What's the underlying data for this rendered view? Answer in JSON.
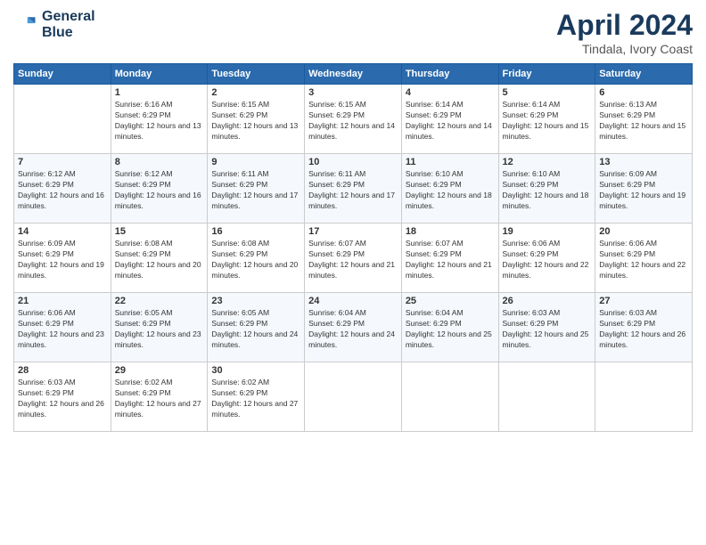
{
  "logo": {
    "line1": "General",
    "line2": "Blue"
  },
  "title": "April 2024",
  "location": "Tindala, Ivory Coast",
  "weekdays": [
    "Sunday",
    "Monday",
    "Tuesday",
    "Wednesday",
    "Thursday",
    "Friday",
    "Saturday"
  ],
  "weeks": [
    [
      {
        "num": "",
        "sunrise": "",
        "sunset": "",
        "daylight": ""
      },
      {
        "num": "1",
        "sunrise": "Sunrise: 6:16 AM",
        "sunset": "Sunset: 6:29 PM",
        "daylight": "Daylight: 12 hours and 13 minutes."
      },
      {
        "num": "2",
        "sunrise": "Sunrise: 6:15 AM",
        "sunset": "Sunset: 6:29 PM",
        "daylight": "Daylight: 12 hours and 13 minutes."
      },
      {
        "num": "3",
        "sunrise": "Sunrise: 6:15 AM",
        "sunset": "Sunset: 6:29 PM",
        "daylight": "Daylight: 12 hours and 14 minutes."
      },
      {
        "num": "4",
        "sunrise": "Sunrise: 6:14 AM",
        "sunset": "Sunset: 6:29 PM",
        "daylight": "Daylight: 12 hours and 14 minutes."
      },
      {
        "num": "5",
        "sunrise": "Sunrise: 6:14 AM",
        "sunset": "Sunset: 6:29 PM",
        "daylight": "Daylight: 12 hours and 15 minutes."
      },
      {
        "num": "6",
        "sunrise": "Sunrise: 6:13 AM",
        "sunset": "Sunset: 6:29 PM",
        "daylight": "Daylight: 12 hours and 15 minutes."
      }
    ],
    [
      {
        "num": "7",
        "sunrise": "Sunrise: 6:12 AM",
        "sunset": "Sunset: 6:29 PM",
        "daylight": "Daylight: 12 hours and 16 minutes."
      },
      {
        "num": "8",
        "sunrise": "Sunrise: 6:12 AM",
        "sunset": "Sunset: 6:29 PM",
        "daylight": "Daylight: 12 hours and 16 minutes."
      },
      {
        "num": "9",
        "sunrise": "Sunrise: 6:11 AM",
        "sunset": "Sunset: 6:29 PM",
        "daylight": "Daylight: 12 hours and 17 minutes."
      },
      {
        "num": "10",
        "sunrise": "Sunrise: 6:11 AM",
        "sunset": "Sunset: 6:29 PM",
        "daylight": "Daylight: 12 hours and 17 minutes."
      },
      {
        "num": "11",
        "sunrise": "Sunrise: 6:10 AM",
        "sunset": "Sunset: 6:29 PM",
        "daylight": "Daylight: 12 hours and 18 minutes."
      },
      {
        "num": "12",
        "sunrise": "Sunrise: 6:10 AM",
        "sunset": "Sunset: 6:29 PM",
        "daylight": "Daylight: 12 hours and 18 minutes."
      },
      {
        "num": "13",
        "sunrise": "Sunrise: 6:09 AM",
        "sunset": "Sunset: 6:29 PM",
        "daylight": "Daylight: 12 hours and 19 minutes."
      }
    ],
    [
      {
        "num": "14",
        "sunrise": "Sunrise: 6:09 AM",
        "sunset": "Sunset: 6:29 PM",
        "daylight": "Daylight: 12 hours and 19 minutes."
      },
      {
        "num": "15",
        "sunrise": "Sunrise: 6:08 AM",
        "sunset": "Sunset: 6:29 PM",
        "daylight": "Daylight: 12 hours and 20 minutes."
      },
      {
        "num": "16",
        "sunrise": "Sunrise: 6:08 AM",
        "sunset": "Sunset: 6:29 PM",
        "daylight": "Daylight: 12 hours and 20 minutes."
      },
      {
        "num": "17",
        "sunrise": "Sunrise: 6:07 AM",
        "sunset": "Sunset: 6:29 PM",
        "daylight": "Daylight: 12 hours and 21 minutes."
      },
      {
        "num": "18",
        "sunrise": "Sunrise: 6:07 AM",
        "sunset": "Sunset: 6:29 PM",
        "daylight": "Daylight: 12 hours and 21 minutes."
      },
      {
        "num": "19",
        "sunrise": "Sunrise: 6:06 AM",
        "sunset": "Sunset: 6:29 PM",
        "daylight": "Daylight: 12 hours and 22 minutes."
      },
      {
        "num": "20",
        "sunrise": "Sunrise: 6:06 AM",
        "sunset": "Sunset: 6:29 PM",
        "daylight": "Daylight: 12 hours and 22 minutes."
      }
    ],
    [
      {
        "num": "21",
        "sunrise": "Sunrise: 6:06 AM",
        "sunset": "Sunset: 6:29 PM",
        "daylight": "Daylight: 12 hours and 23 minutes."
      },
      {
        "num": "22",
        "sunrise": "Sunrise: 6:05 AM",
        "sunset": "Sunset: 6:29 PM",
        "daylight": "Daylight: 12 hours and 23 minutes."
      },
      {
        "num": "23",
        "sunrise": "Sunrise: 6:05 AM",
        "sunset": "Sunset: 6:29 PM",
        "daylight": "Daylight: 12 hours and 24 minutes."
      },
      {
        "num": "24",
        "sunrise": "Sunrise: 6:04 AM",
        "sunset": "Sunset: 6:29 PM",
        "daylight": "Daylight: 12 hours and 24 minutes."
      },
      {
        "num": "25",
        "sunrise": "Sunrise: 6:04 AM",
        "sunset": "Sunset: 6:29 PM",
        "daylight": "Daylight: 12 hours and 25 minutes."
      },
      {
        "num": "26",
        "sunrise": "Sunrise: 6:03 AM",
        "sunset": "Sunset: 6:29 PM",
        "daylight": "Daylight: 12 hours and 25 minutes."
      },
      {
        "num": "27",
        "sunrise": "Sunrise: 6:03 AM",
        "sunset": "Sunset: 6:29 PM",
        "daylight": "Daylight: 12 hours and 26 minutes."
      }
    ],
    [
      {
        "num": "28",
        "sunrise": "Sunrise: 6:03 AM",
        "sunset": "Sunset: 6:29 PM",
        "daylight": "Daylight: 12 hours and 26 minutes."
      },
      {
        "num": "29",
        "sunrise": "Sunrise: 6:02 AM",
        "sunset": "Sunset: 6:29 PM",
        "daylight": "Daylight: 12 hours and 27 minutes."
      },
      {
        "num": "30",
        "sunrise": "Sunrise: 6:02 AM",
        "sunset": "Sunset: 6:29 PM",
        "daylight": "Daylight: 12 hours and 27 minutes."
      },
      {
        "num": "",
        "sunrise": "",
        "sunset": "",
        "daylight": ""
      },
      {
        "num": "",
        "sunrise": "",
        "sunset": "",
        "daylight": ""
      },
      {
        "num": "",
        "sunrise": "",
        "sunset": "",
        "daylight": ""
      },
      {
        "num": "",
        "sunrise": "",
        "sunset": "",
        "daylight": ""
      }
    ]
  ]
}
